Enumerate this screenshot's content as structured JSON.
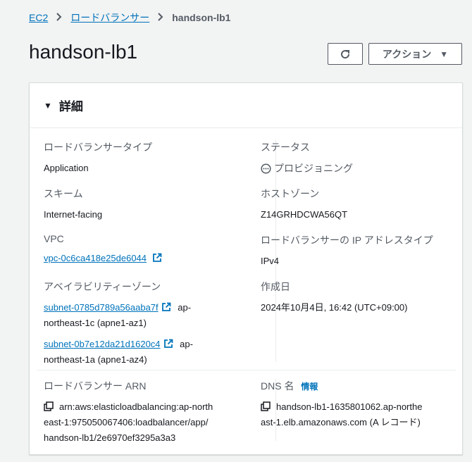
{
  "breadcrumb": {
    "items": [
      "EC2",
      "ロードバランサー"
    ],
    "current": "handson-lb1"
  },
  "page": {
    "title": "handson-lb1",
    "actions_label": "アクション"
  },
  "details": {
    "header": "詳細",
    "lb_type_label": "ロードバランサータイプ",
    "lb_type_value": "Application",
    "status_label": "ステータス",
    "status_value": "プロビジョニング",
    "scheme_label": "スキーム",
    "scheme_value": "Internet-facing",
    "hosted_zone_label": "ホストゾーン",
    "hosted_zone_value": "Z14GRHDCWA56QT",
    "vpc_label": "VPC",
    "vpc_value": "vpc-0c6ca418e25de6044",
    "ip_type_label": "ロードバランサーの IP アドレスタイプ",
    "ip_type_value": "IPv4",
    "az_label": "アベイラビリティーゾーン",
    "subnet1_link": "subnet-0785d789a56aaba7f",
    "subnet1_az1": "ap-",
    "subnet1_az2": "northeast-1c (apne1-az1)",
    "subnet2_link": "subnet-0b7e12da21d1620c4",
    "subnet2_az1": "ap-",
    "subnet2_az2": "northeast-1a (apne1-az4)",
    "created_label": "作成日",
    "created_value": "2024年10月4日, 16:42 (UTC+09:00)",
    "arn_label": "ロードバランサー ARN",
    "arn_line1": "arn:aws:elasticloadbalancing:ap-north",
    "arn_line2": "east-1:975050067406:loadbalancer/app/",
    "arn_line3": "handson-lb1/2e6970ef3295a3a3",
    "dns_label": "DNS 名",
    "dns_info": "情報",
    "dns_line1": "handson-lb1-1635801062.ap-northe",
    "dns_line2": "ast-1.elb.amazonaws.com (A レコード)"
  },
  "colors": {
    "link": "#0073bb",
    "background": "#f2f3f3",
    "text": "#16191f",
    "muted": "#545b64"
  }
}
